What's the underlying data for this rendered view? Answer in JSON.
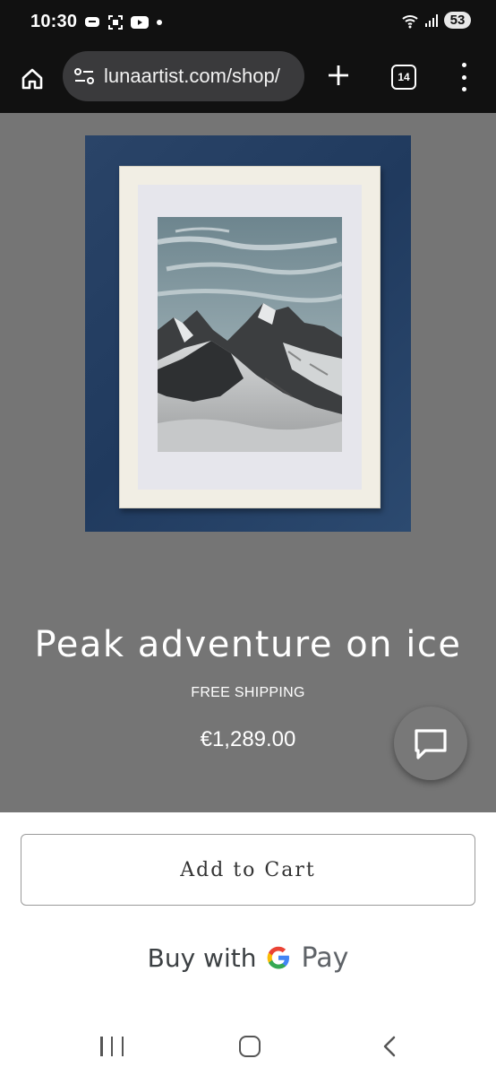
{
  "status_bar": {
    "time": "10:30",
    "battery": "53",
    "icons": [
      "message-icon",
      "screenshot-icon",
      "youtube-icon",
      "dot-icon",
      "wifi-icon",
      "signal-icon"
    ]
  },
  "browser": {
    "url": "lunaartist.com/shop/",
    "tab_count": "14",
    "icons": [
      "home-icon",
      "site-info-icon",
      "plus-icon",
      "tabs-icon",
      "more-vert-icon"
    ]
  },
  "product": {
    "title": "Peak adventure on ice",
    "shipping": "FREE SHIPPING",
    "price": "€1,289.00"
  },
  "actions": {
    "add_to_cart": "Add to Cart",
    "buy_with": "Buy with",
    "pay": "Pay"
  },
  "colors": {
    "page_bg": "#757575",
    "backdrop": "#203a5e",
    "google_blue": "#4285F4",
    "google_red": "#EA4335",
    "google_yellow": "#FBBC05",
    "google_green": "#34A853"
  }
}
